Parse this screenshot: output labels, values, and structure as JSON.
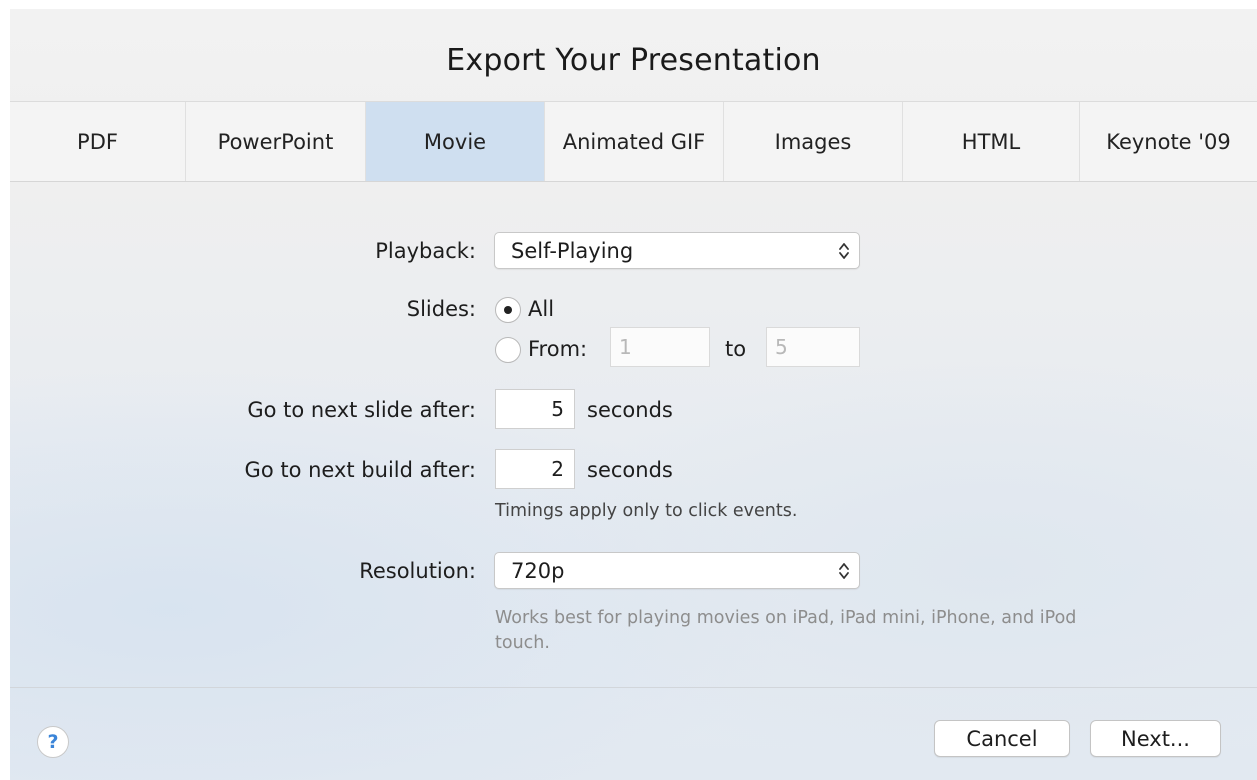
{
  "dialog": {
    "title": "Export Your Presentation"
  },
  "tabs": [
    {
      "label": "PDF",
      "selected": false
    },
    {
      "label": "PowerPoint",
      "selected": false
    },
    {
      "label": "Movie",
      "selected": true
    },
    {
      "label": "Animated GIF",
      "selected": false
    },
    {
      "label": "Images",
      "selected": false
    },
    {
      "label": "HTML",
      "selected": false
    },
    {
      "label": "Keynote '09",
      "selected": false
    }
  ],
  "playback": {
    "label": "Playback:",
    "value": "Self-Playing"
  },
  "slides": {
    "label": "Slides:",
    "all_label": "All",
    "all_selected": true,
    "from_label": "From:",
    "from_value": "1",
    "to_label": "to",
    "to_value": "5"
  },
  "next_slide": {
    "label": "Go to next slide after:",
    "value": "5",
    "unit": "seconds"
  },
  "next_build": {
    "label": "Go to next build after:",
    "value": "2",
    "unit": "seconds"
  },
  "timing_note": "Timings apply only to click events.",
  "resolution": {
    "label": "Resolution:",
    "value": "720p",
    "note": "Works best for playing movies on iPad, iPad mini, iPhone, and iPod touch."
  },
  "footer": {
    "help_label": "?",
    "cancel_label": "Cancel",
    "next_label": "Next..."
  },
  "colors": {
    "selected_tab": "#cfdff0",
    "help_icon": "#3a84d8"
  }
}
